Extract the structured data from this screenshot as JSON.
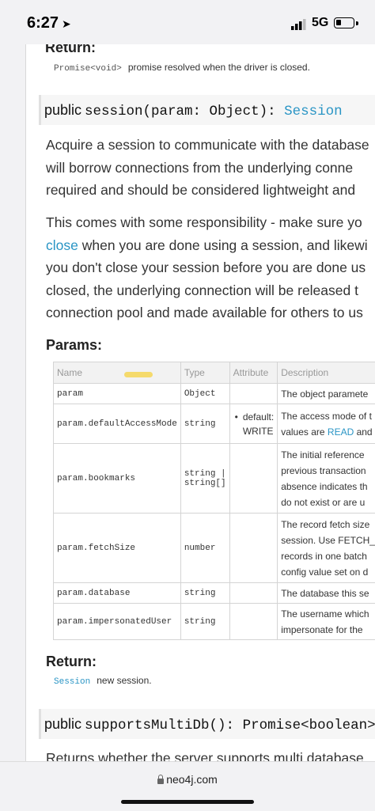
{
  "status_bar": {
    "time": "6:27",
    "network": "5G"
  },
  "top_return": {
    "title": "Return:",
    "type": "Promise<void>",
    "text": "promise resolved when the driver is closed."
  },
  "session_sig": {
    "keyword": "public",
    "signature": "session(param: Object): ",
    "return_type": "Session"
  },
  "para1": {
    "line1": "Acquire a session to communicate with the database",
    "line2": "will borrow connections from the underlying conne",
    "line3": "required and should be considered lightweight and"
  },
  "para2": {
    "line1": "This comes with some responsibility - make sure yo",
    "line2_link": "close",
    "line2_rest": " when you are done using a session, and likewi",
    "line3": "you don't close your session before you are done us",
    "line4": "closed, the underlying connection will be released t",
    "line5": "connection pool and made available for others to us"
  },
  "params": {
    "title": "Params:",
    "headers": {
      "name": "Name",
      "type": "Type",
      "attribute": "Attribute",
      "description": "Description"
    },
    "rows": [
      {
        "name": "param",
        "type": "Object",
        "attribute": "",
        "desc": [
          "The object paramete"
        ]
      },
      {
        "name": "param.defaultAccessMode",
        "type": "string",
        "attribute": "default: WRITE",
        "desc": [
          "The access mode of t",
          "values are READ and"
        ]
      },
      {
        "name": "param.bookmarks",
        "type": "string | string[]",
        "attribute": "",
        "desc": [
          "The initial reference",
          "previous transaction",
          "absence indicates th",
          "do not exist or are u"
        ]
      },
      {
        "name": "param.fetchSize",
        "type": "number",
        "attribute": "",
        "desc": [
          "The record fetch size",
          "session. Use FETCH_",
          "records in one batch",
          "config value set on d"
        ]
      },
      {
        "name": "param.database",
        "type": "string",
        "attribute": "",
        "desc": [
          "The database this se"
        ]
      },
      {
        "name": "param.impersonatedUser",
        "type": "string",
        "attribute": "",
        "desc": [
          "The username which",
          "impersonate for the"
        ]
      }
    ]
  },
  "session_return": {
    "title": "Return:",
    "type": "Session",
    "text": "new session."
  },
  "multidb_sig": {
    "keyword": "public",
    "signature": "supportsMultiDb(): Promise<boolean>"
  },
  "cut_text": "Returns whether the server supports multi database",
  "url": "neo4j.com",
  "colors": {
    "link": "#2a95c5",
    "highlight": "#f5d34a"
  }
}
